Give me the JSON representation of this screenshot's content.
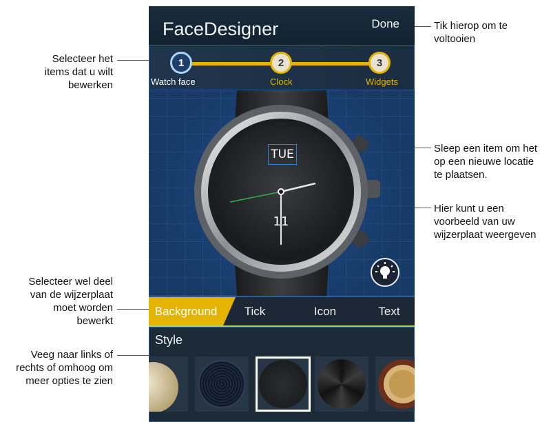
{
  "app": {
    "title": "FaceDesigner",
    "done_label": "Done"
  },
  "stepper": {
    "steps": [
      {
        "number": "1",
        "label": "Watch face",
        "state": "active"
      },
      {
        "number": "2",
        "label": "Clock",
        "state": "idle"
      },
      {
        "number": "3",
        "label": "Widgets",
        "state": "idle"
      }
    ]
  },
  "watch": {
    "day": "TUE",
    "date": "11"
  },
  "tabs": [
    {
      "label": "Background",
      "selected": true
    },
    {
      "label": "Tick",
      "selected": false
    },
    {
      "label": "Icon",
      "selected": false
    },
    {
      "label": "Text",
      "selected": false
    }
  ],
  "style_panel": {
    "label": "Style",
    "selected_index": 2
  },
  "callouts": {
    "done": [
      "Tik hierop om te",
      "voltooien"
    ],
    "select_items": [
      "Selecteer het",
      "items dat u wilt",
      "bewerken"
    ],
    "drag_item": [
      "Sleep een item om het",
      "op een nieuwe locatie",
      "te plaatsen."
    ],
    "preview": [
      "Hier kunt u een",
      "voorbeeld van uw",
      "wijzerplaat weergeven"
    ],
    "select_part": [
      "Selecteer wel deel",
      "van de wijzerplaat",
      "moet worden",
      "bewerkt"
    ],
    "swipe": [
      "Veeg naar links of",
      "rechts of omhoog om",
      "meer opties te zien"
    ]
  },
  "colors": {
    "accent": "#e4b400",
    "frame_blue": "#2b5d9a",
    "app_bg": "#0d1e2e"
  },
  "icons": {
    "tips": "lightbulb-icon"
  }
}
